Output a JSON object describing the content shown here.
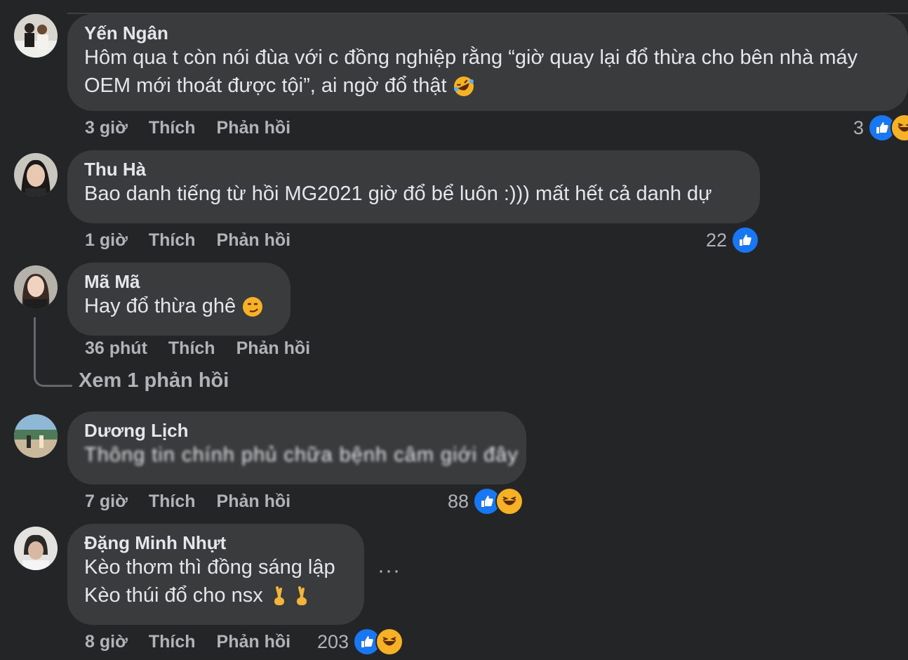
{
  "comments": [
    {
      "author": "Yến Ngân",
      "lines": [
        "Hôm qua t còn nói đùa với c đồng nghiệp rằng “giờ quay lại đổ thừa cho bên nhà máy",
        "OEM mới thoát được tội”, ai ngờ đổ thật"
      ],
      "time": "3 giờ",
      "like_label": "Thích",
      "reply_label": "Phản hồi",
      "reaction_count": "3"
    },
    {
      "author": "Thu Hà",
      "lines": [
        "Bao danh tiếng từ hồi MG2021 giờ đổ bể luôn :))) mất hết cả danh dự"
      ],
      "time": "1 giờ",
      "like_label": "Thích",
      "reply_label": "Phản hồi",
      "reaction_count": "22"
    },
    {
      "author": "Mã Mã",
      "lines": [
        "Hay đổ thừa ghê"
      ],
      "time": "36 phút",
      "like_label": "Thích",
      "reply_label": "Phản hồi",
      "view_replies": "Xem 1 phản hồi"
    },
    {
      "author": "Dương Lịch",
      "lines": [
        "Thông tin chính phủ chữa bệnh câm giới đây"
      ],
      "time": "7 giờ",
      "like_label": "Thích",
      "reply_label": "Phản hồi",
      "reaction_count": "88"
    },
    {
      "author": "Đặng Minh Nhựt",
      "lines": [
        "Kèo thơm thì đồng sáng lập",
        "Kèo thúi đổ cho nsx"
      ],
      "time": "8 giờ",
      "like_label": "Thích",
      "reply_label": "Phản hồi",
      "reaction_count": "203",
      "more_label": "···"
    }
  ],
  "colors": {
    "background": "#242526",
    "bubble": "#3a3b3c",
    "like_blue": "#1877f2",
    "secondary_text": "#b0b3b8"
  }
}
